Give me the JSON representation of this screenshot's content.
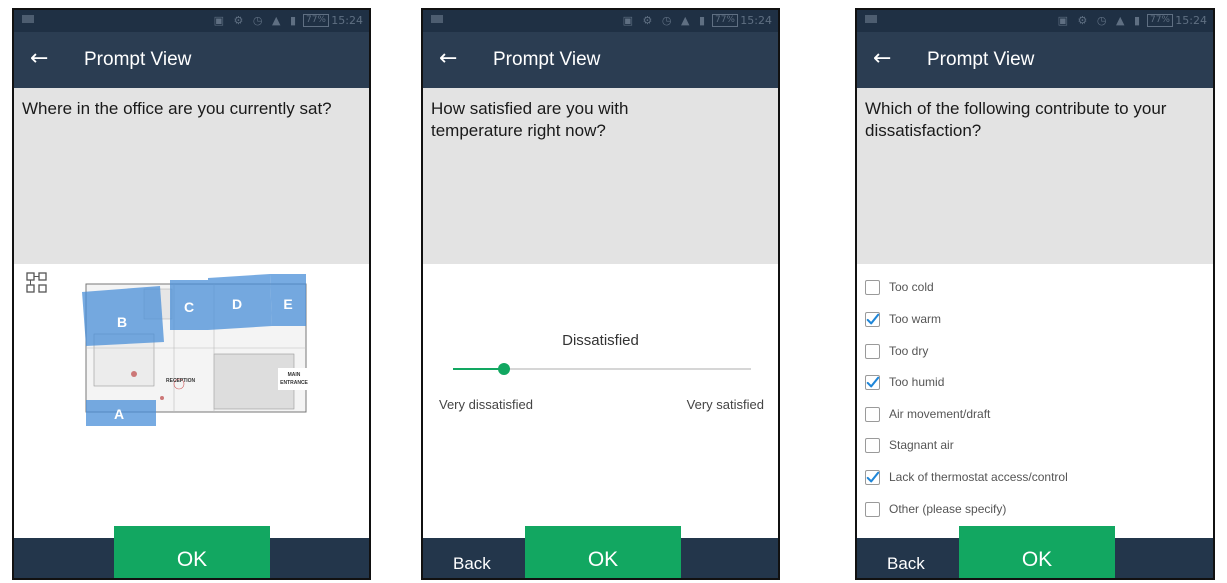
{
  "status_bar": {
    "battery": "77%",
    "time": "15:24"
  },
  "screens": [
    {
      "back_icon": "←",
      "title": "Prompt View",
      "question": "Where in the office are you currently sat?",
      "map": {
        "zones": [
          "A",
          "B",
          "C",
          "D",
          "E"
        ],
        "labels": {
          "reception": "RECEPTION",
          "main_entrance_1": "MAIN",
          "main_entrance_2": "ENTRANCE"
        }
      },
      "ok_label": "OK"
    },
    {
      "back_icon": "←",
      "title": "Prompt View",
      "question": "How satisfied are you with temperature right now?",
      "slider": {
        "value_label": "Dissatisfied",
        "min_label": "Very dissatisfied",
        "max_label": "Very satisfied",
        "level": 0.17
      },
      "back_label": "Back",
      "ok_label": "OK"
    },
    {
      "back_icon": "←",
      "title": "Prompt View",
      "question": "Which of the following contribute to your dissatisfaction?",
      "options": [
        {
          "label": "Too cold",
          "checked": false
        },
        {
          "label": "Too warm",
          "checked": true
        },
        {
          "label": "Too dry",
          "checked": false
        },
        {
          "label": "Too humid",
          "checked": true
        },
        {
          "label": "Air movement/draft",
          "checked": false
        },
        {
          "label": "Stagnant air",
          "checked": false
        },
        {
          "label": "Lack of thermostat access/control",
          "checked": true
        },
        {
          "label": "Other (please specify)",
          "checked": false
        }
      ],
      "back_label": "Back",
      "ok_label": "OK"
    }
  ],
  "colors": {
    "accent": "#12a761",
    "appbar": "#2b3d52",
    "statusbar": "#1f3044",
    "zone": "#4a8fd8",
    "check": "#1f86d8"
  }
}
